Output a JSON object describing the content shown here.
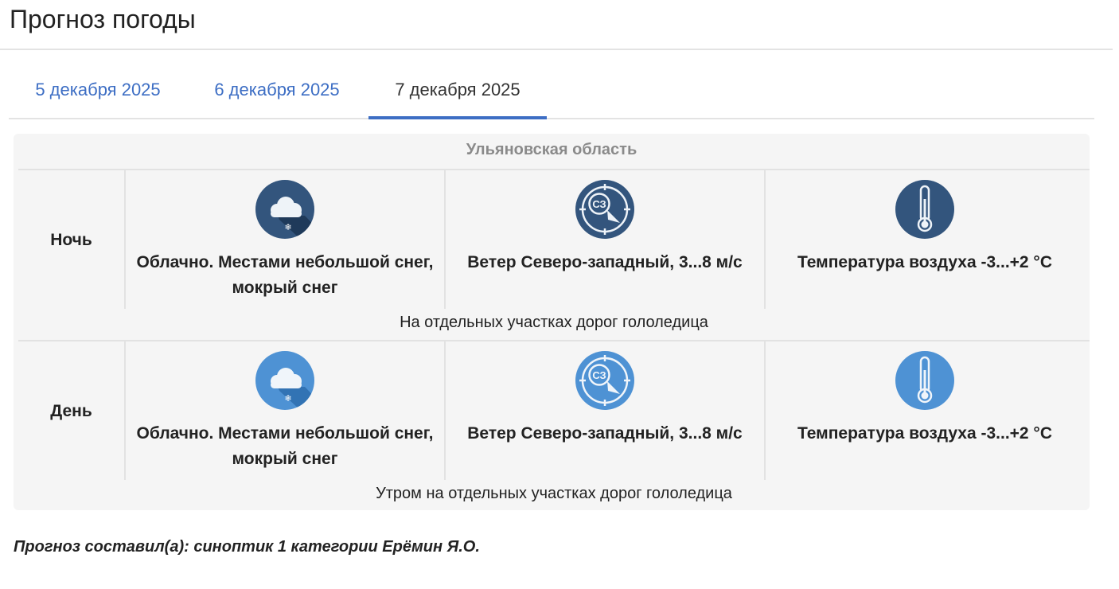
{
  "page": {
    "title": "Прогноз погоды"
  },
  "tabs": [
    {
      "label": "5 декабря 2025",
      "active": false
    },
    {
      "label": "6 декабря 2025",
      "active": false
    },
    {
      "label": "7 декабря 2025",
      "active": true
    }
  ],
  "forecast": {
    "region": "Ульяновская область",
    "night": {
      "label": "Ночь",
      "sky": "Облачно. Местами небольшой снег, мокрый снег",
      "sky_icon": "cloud-snow-icon",
      "wind": "Ветер Северо-западный, 3...8 м/с",
      "wind_icon": "wind-direction-icon",
      "wind_direction_label": "СЗ",
      "temperature": "Температура воздуха -3...+2 °C",
      "temperature_icon": "thermometer-icon",
      "note": "На отдельных участках дорог гололедица",
      "icon_color": "#33557d"
    },
    "day": {
      "label": "День",
      "sky": "Облачно. Местами небольшой снег, мокрый снег",
      "sky_icon": "cloud-snow-icon",
      "wind": "Ветер Северо-западный, 3...8 м/с",
      "wind_icon": "wind-direction-icon",
      "wind_direction_label": "СЗ",
      "temperature": "Температура воздуха -3...+2 °C",
      "temperature_icon": "thermometer-icon",
      "note": "Утром на отдельных участках дорог гололедица",
      "icon_color": "#4e92d4"
    }
  },
  "author": "Прогноз составил(а): синоптик 1 категории Ерёмин Я.О.",
  "colors": {
    "accent": "#3d6ec4",
    "night_icon": "#33557d",
    "day_icon": "#4e92d4"
  }
}
